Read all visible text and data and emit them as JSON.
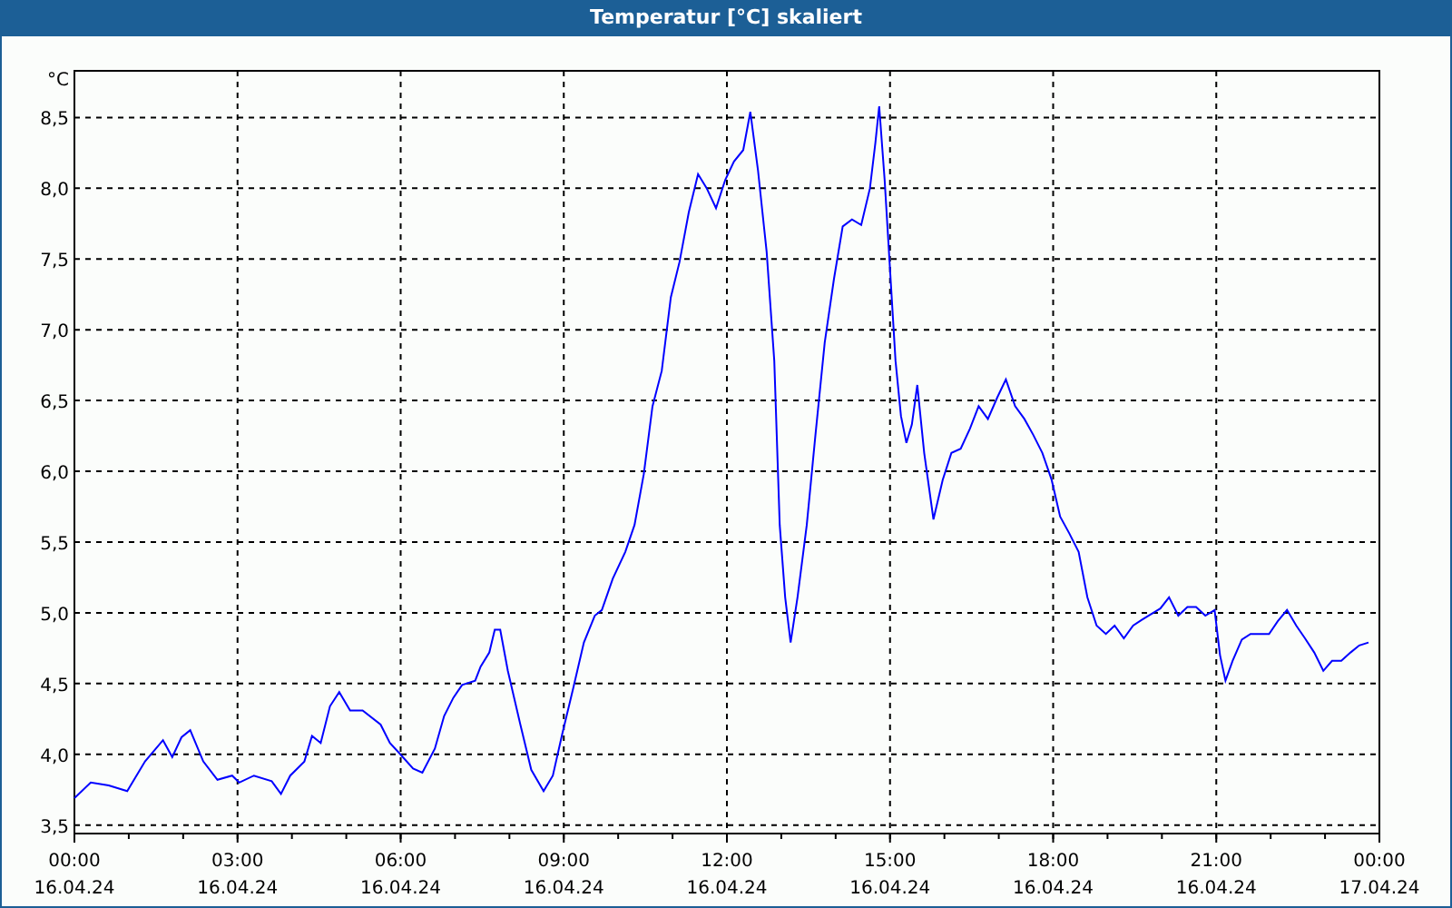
{
  "chart": {
    "chart_data": {
      "type": "line",
      "title": "Temperatur [°C] skaliert",
      "grid": true,
      "ylabel": "°C",
      "xlim": [
        0,
        24
      ],
      "ylim": [
        3.44,
        8.83
      ],
      "yticks": [
        {
          "value": 3.5,
          "label": "3,5"
        },
        {
          "value": 4,
          "label": "4,0"
        },
        {
          "value": 4.5,
          "label": "4,5"
        },
        {
          "value": 5,
          "label": "5,0"
        },
        {
          "value": 5.5,
          "label": "5,5"
        },
        {
          "value": 6,
          "label": "6,0"
        },
        {
          "value": 6.5,
          "label": "6,5"
        },
        {
          "value": 7,
          "label": "7,0"
        },
        {
          "value": 7.5,
          "label": "7,5"
        },
        {
          "value": 8,
          "label": "8,0"
        },
        {
          "value": 8.5,
          "label": "8,5"
        }
      ],
      "xticks": [
        {
          "value": 0,
          "label": "00:00"
        },
        {
          "value": 3,
          "label": "03:00"
        },
        {
          "value": 6,
          "label": "06:00"
        },
        {
          "value": 9,
          "label": "09:00"
        },
        {
          "value": 12,
          "label": "12:00"
        },
        {
          "value": 15,
          "label": "15:00"
        },
        {
          "value": 18,
          "label": "18:00"
        },
        {
          "value": 21,
          "label": "21:00"
        },
        {
          "value": 24,
          "label": "00:00"
        }
      ],
      "x": [
        0,
        0.3,
        0.63,
        0.97,
        1.3,
        1.63,
        1.8,
        1.97,
        2.13,
        2.37,
        2.63,
        2.9,
        3.03,
        3.3,
        3.63,
        3.8,
        3.97,
        4.23,
        4.37,
        4.53,
        4.7,
        4.87,
        5.07,
        5.3,
        5.63,
        5.8,
        5.97,
        6.23,
        6.4,
        6.63,
        6.8,
        6.97,
        7.13,
        7.37,
        7.47,
        7.63,
        7.73,
        7.83,
        7.97,
        8.2,
        8.4,
        8.63,
        8.8,
        8.97,
        9.17,
        9.37,
        9.57,
        9.7,
        9.9,
        10.13,
        10.3,
        10.47,
        10.63,
        10.8,
        10.97,
        11.13,
        11.3,
        11.47,
        11.63,
        11.8,
        11.97,
        12.13,
        12.3,
        12.43,
        12.57,
        12.73,
        12.87,
        12.97,
        13.07,
        13.17,
        13.3,
        13.47,
        13.63,
        13.8,
        13.97,
        14.13,
        14.3,
        14.47,
        14.63,
        14.73,
        14.8,
        14.9,
        15.0,
        15.1,
        15.2,
        15.3,
        15.4,
        15.5,
        15.63,
        15.8,
        15.97,
        16.13,
        16.3,
        16.47,
        16.63,
        16.8,
        16.97,
        17.13,
        17.3,
        17.47,
        17.63,
        17.8,
        17.97,
        18.13,
        18.3,
        18.47,
        18.63,
        18.8,
        18.97,
        19.13,
        19.3,
        19.47,
        19.63,
        19.8,
        19.97,
        20.13,
        20.3,
        20.47,
        20.63,
        20.8,
        20.97,
        21.07,
        21.17,
        21.3,
        21.47,
        21.63,
        21.8,
        21.97,
        22.13,
        22.3,
        22.47,
        22.63,
        22.8,
        22.97,
        23.13,
        23.3,
        23.47,
        23.63,
        23.8
      ],
      "series": [
        {
          "color": "#0000ff",
          "values": [
            3.69,
            3.8,
            3.78,
            3.74,
            3.95,
            4.1,
            3.98,
            4.12,
            4.17,
            3.95,
            3.82,
            3.85,
            3.8,
            3.85,
            3.81,
            3.72,
            3.85,
            3.95,
            4.13,
            4.08,
            4.34,
            4.44,
            4.31,
            4.31,
            4.21,
            4.08,
            4.01,
            3.9,
            3.87,
            4.04,
            4.27,
            4.4,
            4.49,
            4.52,
            4.62,
            4.72,
            4.88,
            4.88,
            4.59,
            4.21,
            3.89,
            3.74,
            3.85,
            4.14,
            4.46,
            4.79,
            4.98,
            5.02,
            5.24,
            5.43,
            5.62,
            5.98,
            6.46,
            6.71,
            7.23,
            7.48,
            7.83,
            8.1,
            8.0,
            7.86,
            8.06,
            8.19,
            8.27,
            8.54,
            8.13,
            7.55,
            6.78,
            5.62,
            5.11,
            4.79,
            5.11,
            5.62,
            6.26,
            6.91,
            7.36,
            7.73,
            7.78,
            7.74,
            8.0,
            8.32,
            8.58,
            8.06,
            7.42,
            6.78,
            6.39,
            6.2,
            6.33,
            6.61,
            6.13,
            5.66,
            5.94,
            6.13,
            6.16,
            6.3,
            6.46,
            6.37,
            6.52,
            6.65,
            6.46,
            6.37,
            6.26,
            6.13,
            5.94,
            5.68,
            5.56,
            5.43,
            5.11,
            4.91,
            4.85,
            4.91,
            4.82,
            4.91,
            4.95,
            4.99,
            5.03,
            5.11,
            4.98,
            5.04,
            5.04,
            4.98,
            5.02,
            4.7,
            4.52,
            4.66,
            4.81,
            4.85,
            4.85,
            4.85,
            4.94,
            5.02,
            4.91,
            4.82,
            4.72,
            4.59,
            4.66,
            4.66,
            4.72,
            4.77,
            4.79
          ]
        }
      ]
    },
    "date_labels": [
      "16.04.24",
      "16.04.24",
      "16.04.24",
      "16.04.24",
      "16.04.24",
      "16.04.24",
      "16.04.24",
      "16.04.24",
      "17.04.24"
    ]
  }
}
